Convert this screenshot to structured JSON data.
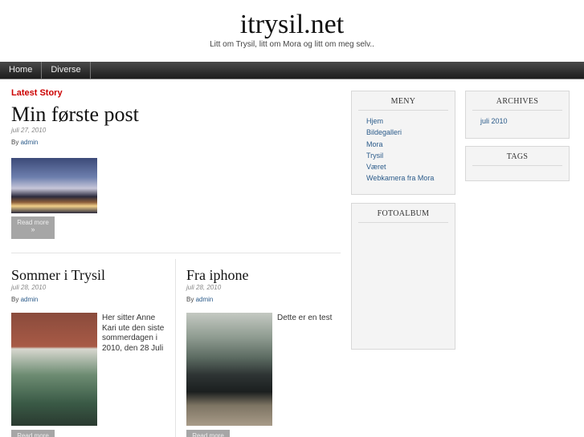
{
  "site": {
    "title": "itrysil.net",
    "description": "Litt om Trysil, litt om Mora og litt om meg selv.."
  },
  "nav": [
    {
      "label": "Home"
    },
    {
      "label": "Diverse"
    }
  ],
  "main": {
    "latest_label": "Latest Story",
    "featured": {
      "title": "Min første post",
      "date": "juli 27, 2010",
      "by": "By",
      "author": "admin",
      "read_more": "Read more",
      "read_more_mark": "»"
    },
    "posts": [
      {
        "title": "Sommer i Trysil",
        "date": "juli 28, 2010",
        "by": "By",
        "author": "admin",
        "excerpt": "Her sitter Anne Kari ute den siste sommerdagen i 2010, den 28 Juli",
        "read_more": "Read more"
      },
      {
        "title": "Fra iphone",
        "date": "juli 28, 2010",
        "by": "By",
        "author": "admin",
        "excerpt": "Dette er en test",
        "read_more": "Read more"
      }
    ]
  },
  "sidebar": {
    "meny": {
      "title": "MENY",
      "items": [
        "Hjem",
        "Bildegalleri",
        "Mora",
        "Trysil",
        "Været",
        "Webkamera fra Mora"
      ]
    },
    "fotoalbum": {
      "title": "FOTOALBUM"
    },
    "archives": {
      "title": "ARCHIVES",
      "items": [
        "juli 2010"
      ]
    },
    "tags": {
      "title": "TAGS"
    }
  },
  "colors": {
    "accent": "#cc0000",
    "link": "#2b5b8a",
    "nav_bg": "#2a2a2a"
  }
}
